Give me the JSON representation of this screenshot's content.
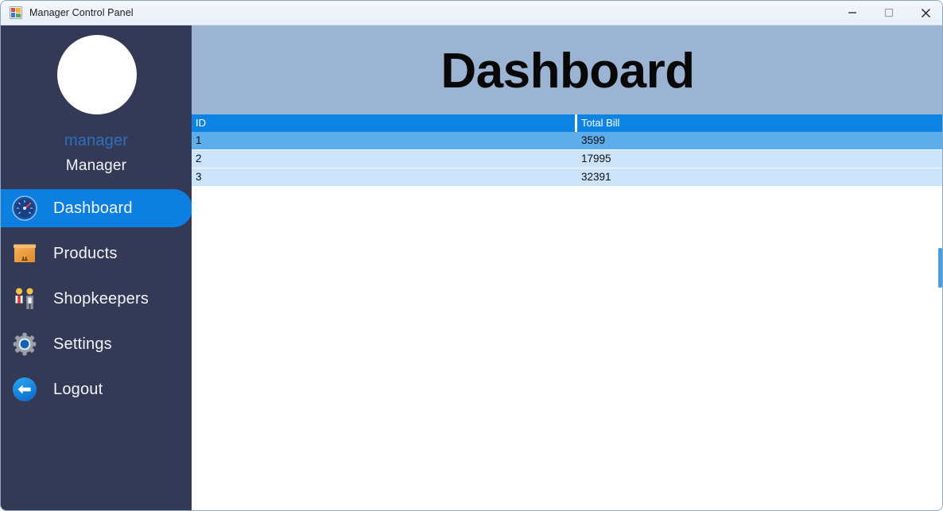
{
  "window": {
    "title": "Manager Control Panel",
    "app_icon": "visual-studio-form-icon",
    "controls": {
      "minimize": "—",
      "maximize": "□",
      "close": "✕"
    }
  },
  "sidebar": {
    "avatar_icon": "user-avatar-placeholder",
    "username": "manager",
    "role": "Manager",
    "background_color": "#343a56",
    "active_color": "#0d7fe0",
    "username_color": "#2e6fc0",
    "items": [
      {
        "label": "Dashboard",
        "icon": "speedometer-icon",
        "active": true
      },
      {
        "label": "Products",
        "icon": "package-box-icon",
        "active": false
      },
      {
        "label": "Shopkeepers",
        "icon": "two-people-icon",
        "active": false
      },
      {
        "label": "Settings",
        "icon": "gear-icon",
        "active": false
      },
      {
        "label": "Logout",
        "icon": "logout-arrow-icon",
        "active": false
      }
    ]
  },
  "main": {
    "page_title": "Dashboard",
    "header_color": "#9bb4d3",
    "table": {
      "header_color": "#0d84e3",
      "selected_row_color": "#5cade9",
      "row_color": "#cce3fa",
      "columns": [
        {
          "key": "id",
          "label": "ID"
        },
        {
          "key": "bill",
          "label": "Total Bill"
        }
      ],
      "rows": [
        {
          "id": "1",
          "bill": "3599",
          "selected": true
        },
        {
          "id": "2",
          "bill": "17995",
          "selected": false
        },
        {
          "id": "3",
          "bill": "32391",
          "selected": false
        }
      ]
    },
    "scrollbar": {
      "visible": true,
      "thumb_color": "#4a9ee0"
    }
  }
}
